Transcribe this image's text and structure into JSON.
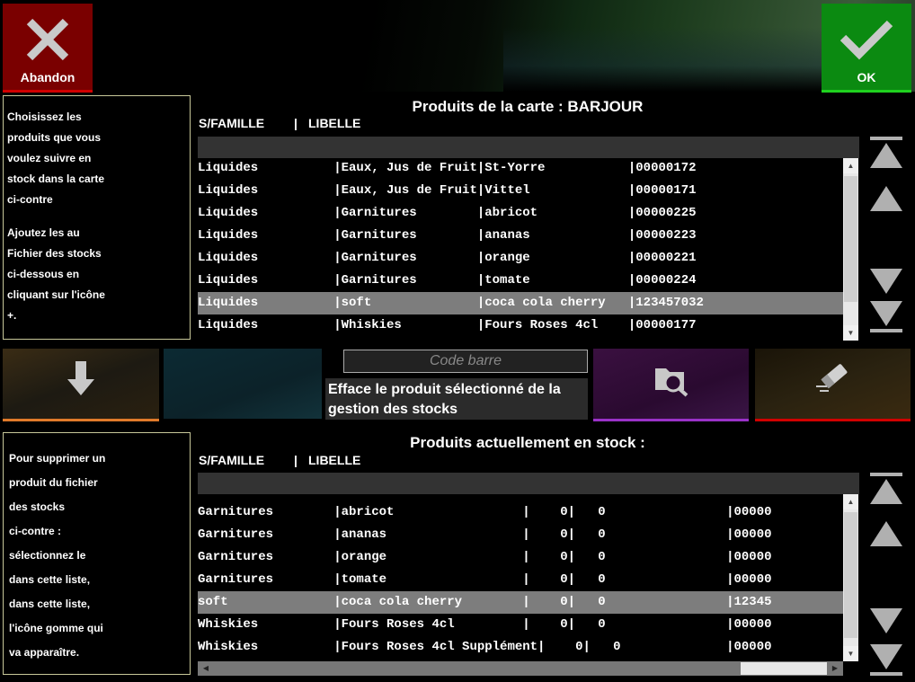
{
  "buttons": {
    "abandon": "Abandon",
    "ok": "OK"
  },
  "info_top": {
    "para1": [
      "Choisissez les",
      "produits que vous",
      "voulez suivre en",
      "stock dans la carte",
      "ci-contre"
    ],
    "para2": [
      "Ajoutez les au",
      "Fichier des stocks",
      "ci-dessous en",
      "cliquant sur l'icône",
      "+."
    ]
  },
  "info_bottom": {
    "lines": [
      "Pour supprimer un",
      "produit du fichier",
      "des stocks",
      "ci-contre :",
      "sélectionnez le",
      "dans cette liste,",
      "dans cette liste,",
      "l'icône gomme qui",
      "va apparaître."
    ]
  },
  "top_list": {
    "title": "Produits de la carte : BARJOUR",
    "col_sfamille": "S/FAMILLE",
    "col_sep": "|",
    "col_libelle": "LIBELLE",
    "rows": [
      "Liquides          |Eaux, Jus de Fruit|St-Yorre           |00000172",
      "Liquides          |Eaux, Jus de Fruit|Vittel             |00000171",
      "Liquides          |Garnitures        |abricot            |00000225",
      "Liquides          |Garnitures        |ananas             |00000223",
      "Liquides          |Garnitures        |orange             |00000221",
      "Liquides          |Garnitures        |tomate             |00000224",
      "Liquides          |soft              |coca cola cherry   |123457032",
      "Liquides          |Whiskies          |Fours Roses 4cl    |00000177"
    ],
    "selected_index": 6
  },
  "middle": {
    "barcode_placeholder": "Code barre",
    "hint": "Efface le produit sélectionné de la gestion des stocks"
  },
  "bottom_list": {
    "title": "Produits actuellement en stock :",
    "col_sfamille": "S/FAMILLE",
    "col_sep": "|",
    "col_libelle": "LIBELLE",
    "rows": [
      "Garnitures        |abricot                 |    0|   0                |00000",
      "Garnitures        |ananas                  |    0|   0                |00000",
      "Garnitures        |orange                  |    0|   0                |00000",
      "Garnitures        |tomate                  |    0|   0                |00000",
      "soft              |coca cola cherry        |    0|   0                |12345",
      "Whiskies          |Fours Roses 4cl         |    0|   0                |00000",
      "Whiskies          |Fours Roses 4cl Supplément|    0|   0              |00000"
    ],
    "selected_index": 4
  },
  "colors": {
    "abandon": "#7a0000",
    "ok": "#0b8a11",
    "selection": "#7d7d7d",
    "purple_accent": "#9a32c8",
    "red_accent": "#d10000",
    "orange_accent": "#e07a2a"
  },
  "icons": [
    "close-icon",
    "check-icon",
    "arrow-down-icon",
    "folder-search-icon",
    "eraser-icon",
    "scroll-top-icon",
    "scroll-up-icon",
    "scroll-down-icon",
    "scroll-bottom-icon"
  ]
}
